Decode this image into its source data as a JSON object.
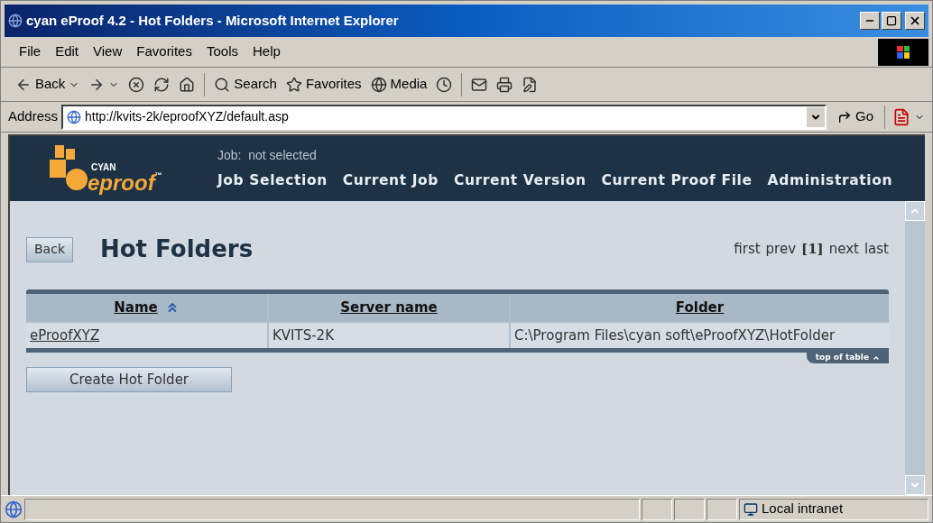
{
  "window": {
    "title": "cyan eProof 4.2 - Hot Folders - Microsoft Internet Explorer"
  },
  "menu": [
    "File",
    "Edit",
    "View",
    "Favorites",
    "Tools",
    "Help"
  ],
  "toolbar": [
    {
      "kind": "back",
      "label": "Back"
    },
    {
      "kind": "forward"
    },
    {
      "kind": "stop"
    },
    {
      "kind": "refresh"
    },
    {
      "kind": "home"
    },
    {
      "kind": "search",
      "label": "Search"
    },
    {
      "kind": "favorites",
      "label": "Favorites"
    },
    {
      "kind": "media",
      "label": "Media"
    },
    {
      "kind": "history"
    },
    {
      "kind": "mail"
    },
    {
      "kind": "print"
    },
    {
      "kind": "edit"
    }
  ],
  "address": {
    "label": "Address",
    "url": "http://kvits-2k/eproofXYZ/default.asp",
    "go": "Go"
  },
  "app": {
    "logo": {
      "top": "CYAN",
      "main": "eproof",
      "mark": "™"
    },
    "job_status": "Job:  not selected",
    "nav": [
      "Job Selection",
      "Current Job",
      "Current Version",
      "Current Proof File",
      "Administration"
    ]
  },
  "page": {
    "back_button": "Back",
    "heading": "Hot Folders",
    "pagination": [
      {
        "label": "first",
        "selected": false
      },
      {
        "label": "prev",
        "selected": false
      },
      {
        "label": "[1]",
        "selected": true
      },
      {
        "label": "next",
        "selected": false
      },
      {
        "label": "last",
        "selected": false
      }
    ],
    "table": {
      "columns": [
        {
          "label": "Name",
          "sorted": true
        },
        {
          "label": "Server name",
          "sorted": false
        },
        {
          "label": "Folder",
          "sorted": false
        }
      ],
      "rows": [
        [
          "eProofXYZ",
          "KVITS-2K",
          "C:\\Program Files\\cyan soft\\eProofXYZ\\HotFolder"
        ]
      ]
    },
    "top_of_table": "top of table",
    "create_button": "Create Hot Folder"
  },
  "status_bar": {
    "zone": "Local intranet"
  }
}
